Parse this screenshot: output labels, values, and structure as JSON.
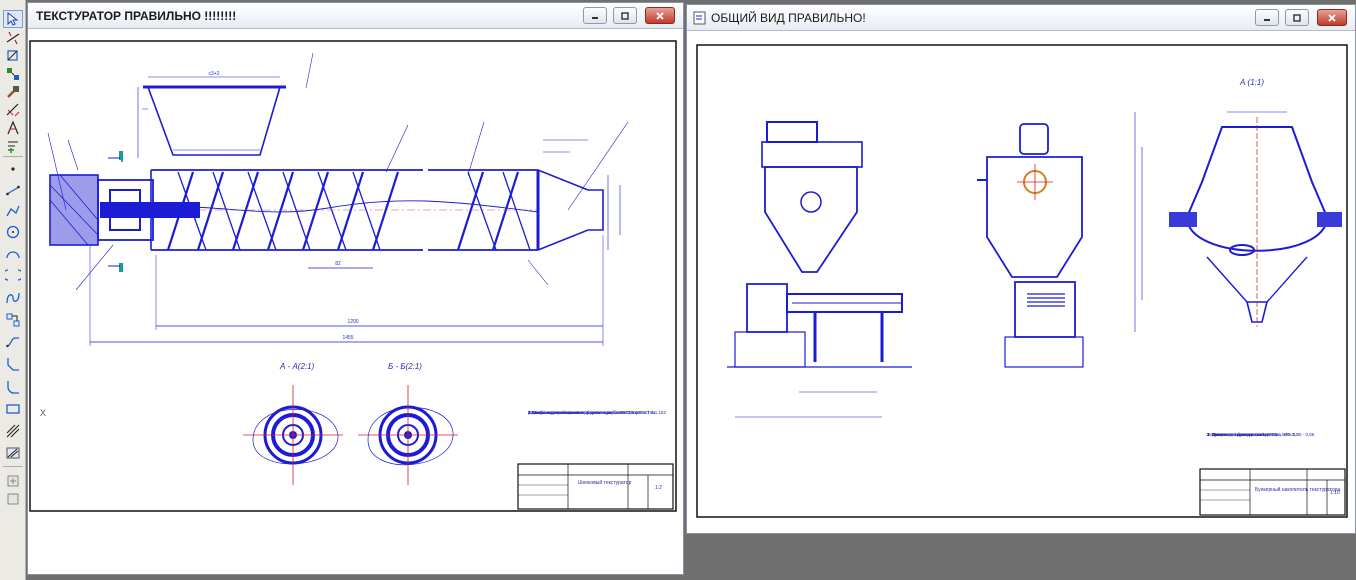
{
  "windows": {
    "left": {
      "title": "ТЕКСТУРАТОР ПРАВИЛЬНО !!!!!!!!",
      "drawing": {
        "section_a": "А - А(2:1)",
        "section_b": "Б - Б(2:1)",
        "notes": [
          "Технические требования к сборке",
          "1.Наибольшие зазоры между деталями",
          "2.Шнек не должен касаться стенок корпуса ГОСТ 2х ГОСТ 2.1.152",
          "3.Допускается отклонение оси шнека не более 0,5 мм",
          "размеры и данные выше относятся к рабочим поверхностям"
        ],
        "stamp_title": "Шнековый текстуратор",
        "stamp_sheet": "1:2"
      }
    },
    "right": {
      "title": "ОБЩИЙ ВИД ПРАВИЛЬНО!",
      "drawing": {
        "view_label": "А (1:1)",
        "notes": [
          "Техническая характеристика",
          "1. Производительность, кг/ч                    1000",
          "2. Давление в бункере-накопителе, МПа    0,45 - 0,55",
          "3. Количество шнеков, шт                             1",
          "4. Мощность привода текстуратора, кВт            2,4"
        ],
        "stamp_title": "Бункерный накопитель текстуратора",
        "stamp_sheet": "1:10"
      }
    }
  },
  "toolbar": {
    "items": [
      "select-pointer",
      "dimension",
      "geometry",
      "edit",
      "parameterize",
      "measure",
      "select",
      "specification",
      "reports",
      "sketch-text",
      "point",
      "segment",
      "polyline",
      "circle",
      "arc",
      "spline",
      "auxiliary-line",
      "chamfer",
      "fillet",
      "rectangle",
      "hatch",
      "macro",
      "insert"
    ]
  },
  "coords": {
    "axis_x": "X"
  }
}
